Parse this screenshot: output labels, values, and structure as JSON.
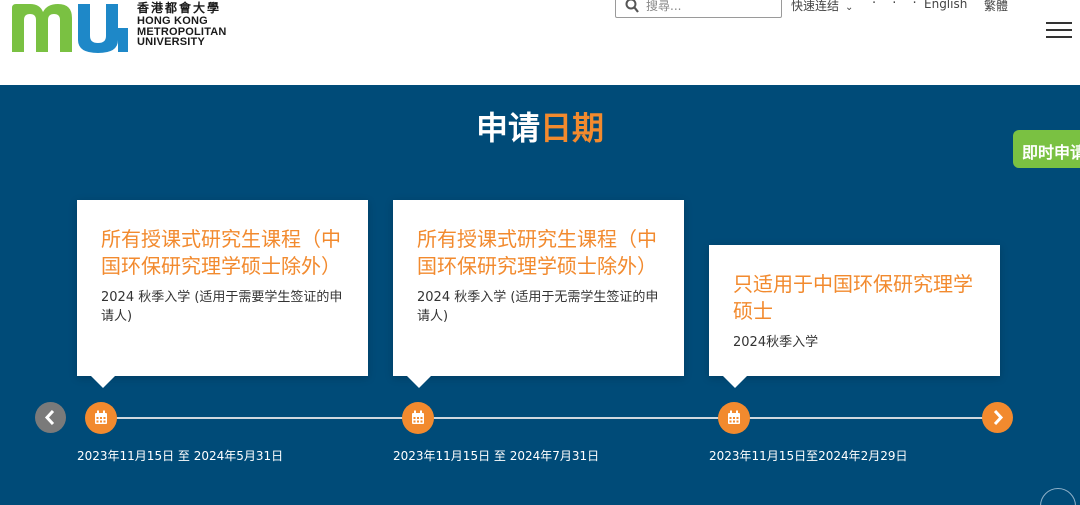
{
  "header": {
    "logo_mark": "mu",
    "logo_zh": "香港都會大學",
    "logo_en": [
      "HONG KONG",
      "METROPOLITAN",
      "UNIVERSITY"
    ],
    "search_placeholder": "搜尋...",
    "quick_links": "快速连结",
    "more": "· · ·",
    "lang_en": "English",
    "lang_tc": "繁體"
  },
  "section": {
    "title_main": "申请",
    "title_highlight": "日期",
    "apply_now": "即时申请"
  },
  "cards": [
    {
      "title": "所有授课式研究生课程（中国环保研究理学硕士除外）",
      "subtitle": "2024 秋季入学 (适用于需要学生签证的申请人)",
      "date": "2023年11月15日 至 2024年5月31日"
    },
    {
      "title": "所有授课式研究生课程（中国环保研究理学硕士除外）",
      "subtitle": "2024 秋季入学 (适用于无需学生签证的申请人)",
      "date": "2023年11月15日 至 2024年7月31日"
    },
    {
      "title": "只适用于中国环保研究理学硕士",
      "subtitle": "2024秋季入学",
      "date": "2023年11月15日至2024年2月29日"
    }
  ],
  "icons": {
    "search": "search-icon",
    "chevron": "chevron-down-icon",
    "menu": "hamburger-icon",
    "calendar": "calendar-icon",
    "prev": "chevron-left-icon",
    "next": "chevron-right-icon"
  },
  "colors": {
    "band": "#004b78",
    "accent": "#f28a2e",
    "apply": "#7ac142",
    "logo_green": "#7ac142",
    "logo_blue": "#1e88c8"
  }
}
